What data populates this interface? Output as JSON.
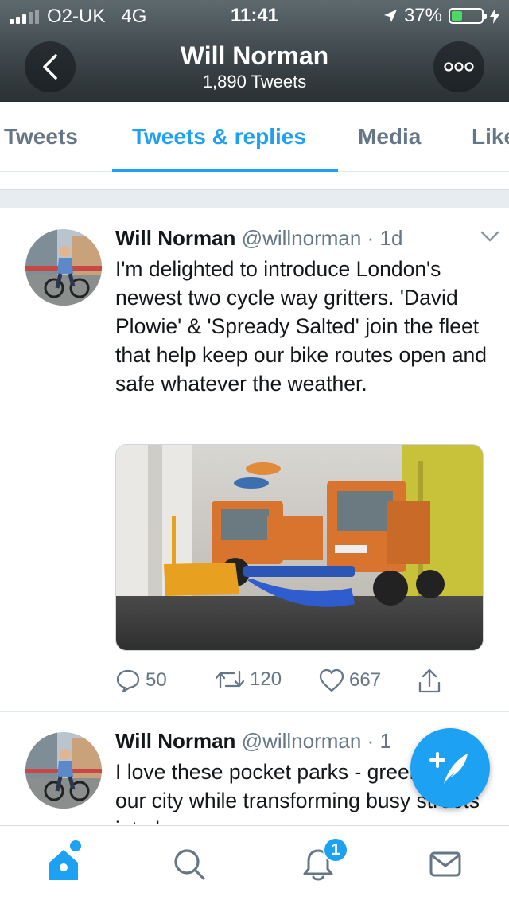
{
  "status_bar": {
    "carrier": "O2-UK",
    "network": "4G",
    "time": "11:41",
    "battery": "37%"
  },
  "header": {
    "title": "Will Norman",
    "subtitle": "1,890 Tweets"
  },
  "tabs": [
    {
      "label": "Tweets",
      "active": false
    },
    {
      "label": "Tweets & replies",
      "active": true
    },
    {
      "label": "Media",
      "active": false
    },
    {
      "label": "Likes",
      "active": false
    }
  ],
  "tweets": [
    {
      "name": "Will Norman",
      "handle": "@willnorman",
      "dot": "·",
      "time": "1d",
      "text": "I'm delighted to introduce London's newest two cycle way gritters. 'David Plowie' & 'Spready Salted' join the fleet that help keep our bike routes open and safe whatever the weather.",
      "replies": "50",
      "retweets": "120",
      "likes": "667"
    },
    {
      "name": "Will Norman",
      "handle": "@willnorman",
      "dot": "·",
      "time": "1",
      "text": "I love these pocket parks - greening up our city while transforming busy streets into low"
    }
  ],
  "bottom_nav": {
    "notifications_badge": "1"
  },
  "colors": {
    "accent": "#1da1f2",
    "text": "#14171a",
    "secondary": "#657786"
  },
  "icons": [
    "back-icon",
    "more-icon",
    "caret-down-icon",
    "reply-icon",
    "retweet-icon",
    "like-icon",
    "share-icon",
    "compose-icon",
    "home-icon",
    "search-icon",
    "notifications-icon",
    "messages-icon"
  ]
}
